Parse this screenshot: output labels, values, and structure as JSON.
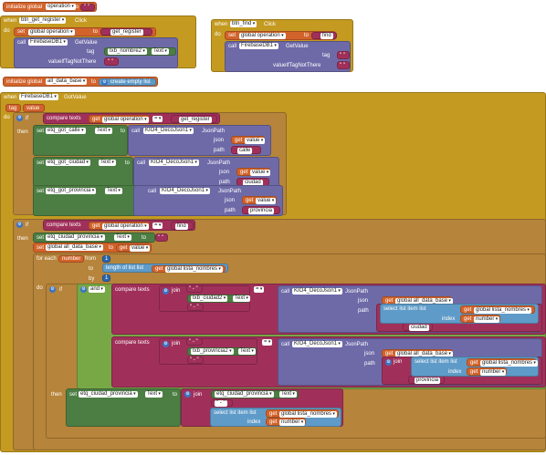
{
  "b1": {
    "init": "initialize global",
    "name": "operation",
    "to": "to",
    "value": "\" \""
  },
  "b2": {
    "when": "when",
    "component": "btn_get_register",
    "event": "Click",
    "do": "do",
    "set": "set",
    "var": "global operation",
    "to": "to",
    "value": "get_register",
    "call": "call",
    "db": "FirebaseDB1",
    "method": "GetValue",
    "tag": "tag",
    "tag_comp": "txb_nombre2",
    "tag_prop": "Text",
    "vitn": "valueIfTagNotThere",
    "empty": "\" \""
  },
  "b3": {
    "when": "when",
    "component": "btn_find",
    "event": "Click",
    "do": "do",
    "set": "set",
    "var": "global operation",
    "to": "to",
    "value": "find",
    "call": "call",
    "db": "FirebaseDB1",
    "method": "GetValue",
    "tag": "tag",
    "tag_val": "\" \"",
    "vitn": "valueIfTagNotThere",
    "empty": "\" \""
  },
  "b4": {
    "init": "initialize global",
    "name": "all_data_base",
    "to": "to",
    "value": "create empty list"
  },
  "b5": {
    "when": "when",
    "component": "FirebaseDB1",
    "event": "GotValue",
    "p_tag": "tag",
    "p_value": "value",
    "do": "do",
    "if": "if",
    "then": "then",
    "compare": "compare texts",
    "get": "get",
    "gvar_op": "global operation",
    "eq": "=",
    "v_get_register": "get_register",
    "v_find": "find",
    "set": "set",
    "to": "to",
    "text": "Text",
    "call": "call",
    "json_comp": "KIO4_DecoJson1",
    "jsonpath": "JsonPath",
    "json": "json",
    "path": "path",
    "comp_calle": "etq_got_calle",
    "comp_ciudad": "etq_got_ciudad",
    "comp_provincia": "etq_got_provincia",
    "comp_ciudad_provincia": "etq_ciudad_provincia",
    "p_calle": "calle",
    "p_ciudad": "ciudad",
    "p_provincia": "provincia",
    "gvar_db": "global all_data_base",
    "value": "value",
    "for_each": "for each",
    "number": "number",
    "from": "from",
    "to_kw": "to",
    "by": "by",
    "n1": "1",
    "length": "length of list  list",
    "gvar_names": "global lista_nombres",
    "and": "and",
    "join": "join",
    "dash": "\" - \"",
    "txb_ciudad": "txb_ciudad2",
    "txb_provincia": "txb_provincia2",
    "select": "select list item  list",
    "index": "index",
    "get_number": "number",
    "dash_short": "\" - \""
  }
}
